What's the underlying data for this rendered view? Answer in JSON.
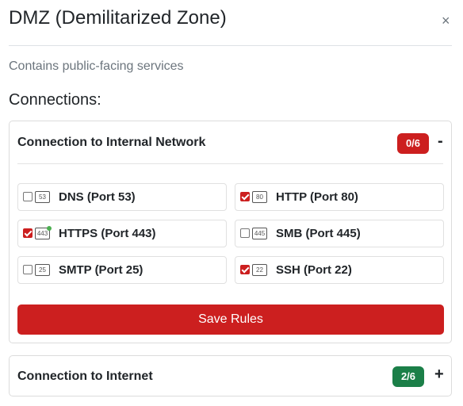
{
  "dialog": {
    "title": "DMZ (Demilitarized Zone)",
    "close_glyph": "×",
    "description": "Contains public-facing services",
    "connections_heading": "Connections:"
  },
  "connections": [
    {
      "title": "Connection to Internal Network",
      "badge": "0/6",
      "badge_color": "#cc1f1f",
      "toggle": "-",
      "expanded": true,
      "rules": [
        {
          "label": "DNS (Port 53)",
          "port": "53",
          "checked": false
        },
        {
          "label": "HTTP (Port 80)",
          "port": "80",
          "checked": true
        },
        {
          "label": "HTTPS (Port 443)",
          "port": "443",
          "checked": true
        },
        {
          "label": "SMB (Port 445)",
          "port": "445",
          "checked": false
        },
        {
          "label": "SMTP (Port 25)",
          "port": "25",
          "checked": false
        },
        {
          "label": "SSH (Port 22)",
          "port": "22",
          "checked": true
        }
      ],
      "save_label": "Save Rules"
    },
    {
      "title": "Connection to Internet",
      "badge": "2/6",
      "badge_color": "#1b7f48",
      "toggle": "+",
      "expanded": false
    }
  ],
  "colors": {
    "accent_red": "#cc1f1f",
    "success_green": "#1b7f48"
  }
}
